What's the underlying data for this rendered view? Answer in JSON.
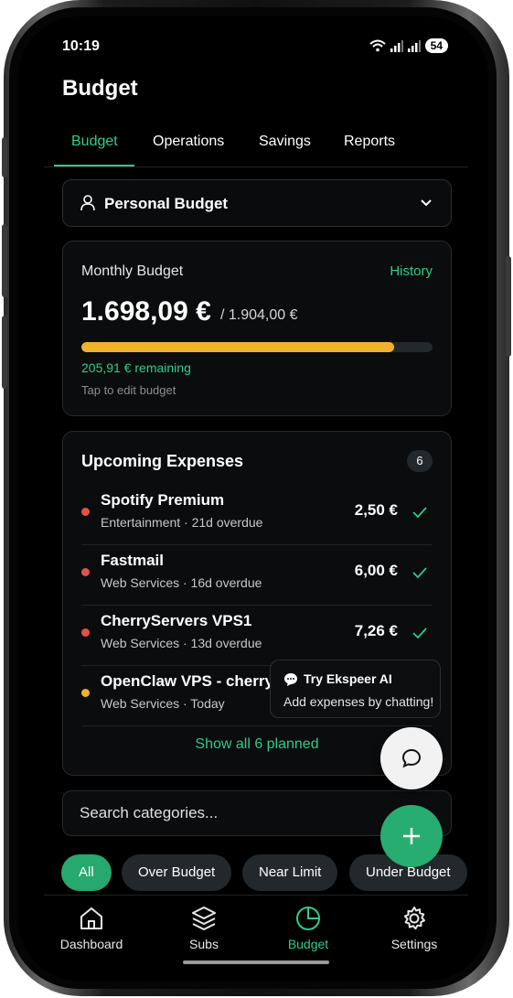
{
  "status_bar": {
    "time": "10:19",
    "battery": "54"
  },
  "header": {
    "title": "Budget"
  },
  "tabs": [
    {
      "label": "Budget"
    },
    {
      "label": "Operations"
    },
    {
      "label": "Savings"
    },
    {
      "label": "Reports"
    }
  ],
  "budget_selector": {
    "label": "Personal Budget",
    "icon": "user-icon"
  },
  "monthly_budget": {
    "title": "Monthly Budget",
    "history_link": "History",
    "spent": "1.698,09 €",
    "total": "/ 1.904,00 €",
    "progress_fraction": 0.89,
    "remaining": "205,91 € remaining",
    "hint": "Tap to edit budget"
  },
  "upcoming_expenses": {
    "title": "Upcoming Expenses",
    "count": "6",
    "items": [
      {
        "name": "Spotify Premium",
        "subtitle": "Entertainment · 21d overdue",
        "amount": "2,50 €",
        "status_color": "#e0524a"
      },
      {
        "name": "Fastmail",
        "subtitle": "Web Services · 16d overdue",
        "amount": "6,00 €",
        "status_color": "#e0524a"
      },
      {
        "name": "CherryServers VPS1",
        "subtitle": "Web Services · 13d overdue",
        "amount": "7,26 €",
        "status_color": "#e0524a"
      },
      {
        "name": "OpenClaw VPS - cherrys",
        "subtitle": "Web Services · Today",
        "amount": "",
        "status_color": "#f2b12a"
      }
    ],
    "show_all": "Show all 6 planned"
  },
  "ai_tooltip": {
    "title": "Try Ekspeer AI",
    "subtitle": "Add expenses by chatting!"
  },
  "search": {
    "placeholder": "Search categories..."
  },
  "filter_chips": [
    {
      "label": "All"
    },
    {
      "label": "Over Budget"
    },
    {
      "label": "Near Limit"
    },
    {
      "label": "Under Budget"
    }
  ],
  "bottom_nav": [
    {
      "label": "Dashboard",
      "icon": "home-icon"
    },
    {
      "label": "Subs",
      "icon": "layers-icon"
    },
    {
      "label": "Budget",
      "icon": "pie-chart-icon"
    },
    {
      "label": "Settings",
      "icon": "gear-icon"
    }
  ],
  "colors": {
    "accent": "#2ecc8a",
    "progress": "#f2b12a",
    "overdue": "#e0524a",
    "background": "#000000"
  }
}
